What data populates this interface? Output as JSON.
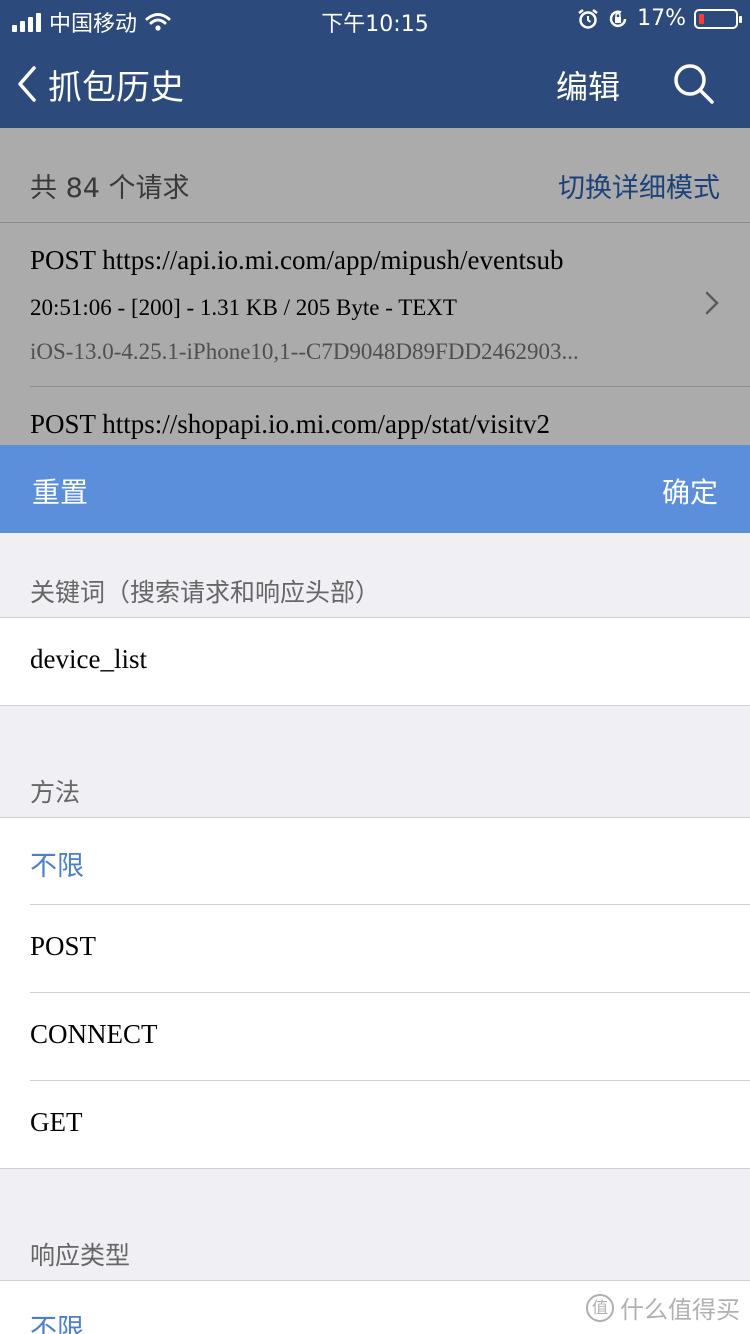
{
  "status_bar": {
    "carrier": "中国移动",
    "time": "下午10:15",
    "battery": "17%"
  },
  "nav": {
    "title": "抓包历史",
    "edit": "编辑"
  },
  "list": {
    "count_label": "共 84 个请求",
    "toggle_mode": "切换详细模式",
    "requests": [
      {
        "url": "POST https://api.io.mi.com/app/mipush/eventsub",
        "meta": "20:51:06 - [200] - 1.31 KB / 205 Byte - TEXT",
        "ua": "iOS-13.0-4.25.1-iPhone10,1--C7D9048D89FDD2462903..."
      },
      {
        "url": "POST https://shopapi.io.mi.com/app/stat/visitv2"
      }
    ]
  },
  "filter": {
    "reset": "重置",
    "confirm": "确定",
    "keyword_section": "关键词（搜索请求和响应头部）",
    "keyword_value": "device_list",
    "method_section": "方法",
    "methods": [
      "不限",
      "POST",
      "CONNECT",
      "GET"
    ],
    "response_section": "响应类型",
    "response_types": [
      "不限"
    ]
  },
  "watermark": "什么值得买"
}
